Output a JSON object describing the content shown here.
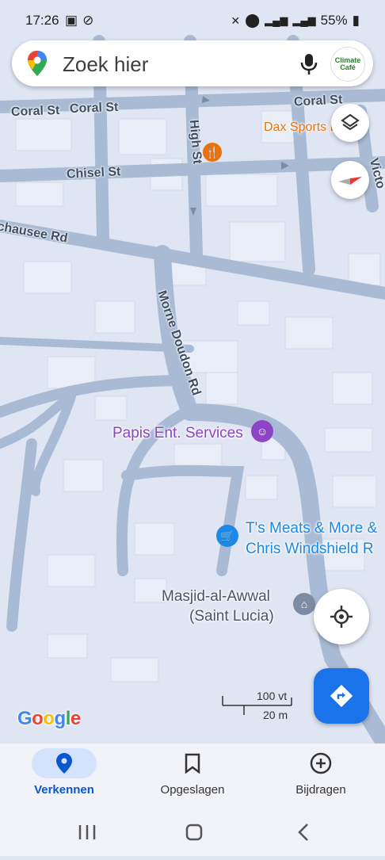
{
  "status_bar": {
    "time": "17:26",
    "battery": "55%"
  },
  "search": {
    "placeholder": "Zoek hier",
    "avatar_text": "Climate Café"
  },
  "map": {
    "streets": [
      {
        "name": "Coral St"
      },
      {
        "name": "Coral St"
      },
      {
        "name": "Coral St"
      },
      {
        "name": "High St"
      },
      {
        "name": "Chisel St"
      },
      {
        "name": "chausee Rd"
      },
      {
        "name": "Morne Doudon Rd"
      },
      {
        "name": "Victo"
      }
    ],
    "pois": [
      {
        "name": "Dax Sports L"
      },
      {
        "name": "Papis Ent. Services"
      },
      {
        "name": "T's Meats & More &"
      },
      {
        "name": "Chris Windshield R"
      },
      {
        "name": "Masjid-al-Awwal"
      },
      {
        "name": "(Saint Lucia)"
      }
    ],
    "scale": {
      "imperial": "100 vt",
      "metric": "20 m"
    },
    "attribution": "Google"
  },
  "bottom_nav": {
    "items": [
      {
        "label": "Verkennen",
        "active": true
      },
      {
        "label": "Opgeslagen",
        "active": false
      },
      {
        "label": "Bijdragen",
        "active": false
      }
    ]
  },
  "colors": {
    "accent": "#1a73e8",
    "map_bg": "#dfe5f2",
    "road": "#a9bbd4",
    "poi_purple": "#8e44c7",
    "poi_blue": "#1e88e5",
    "poi_orange": "#e8710a"
  }
}
